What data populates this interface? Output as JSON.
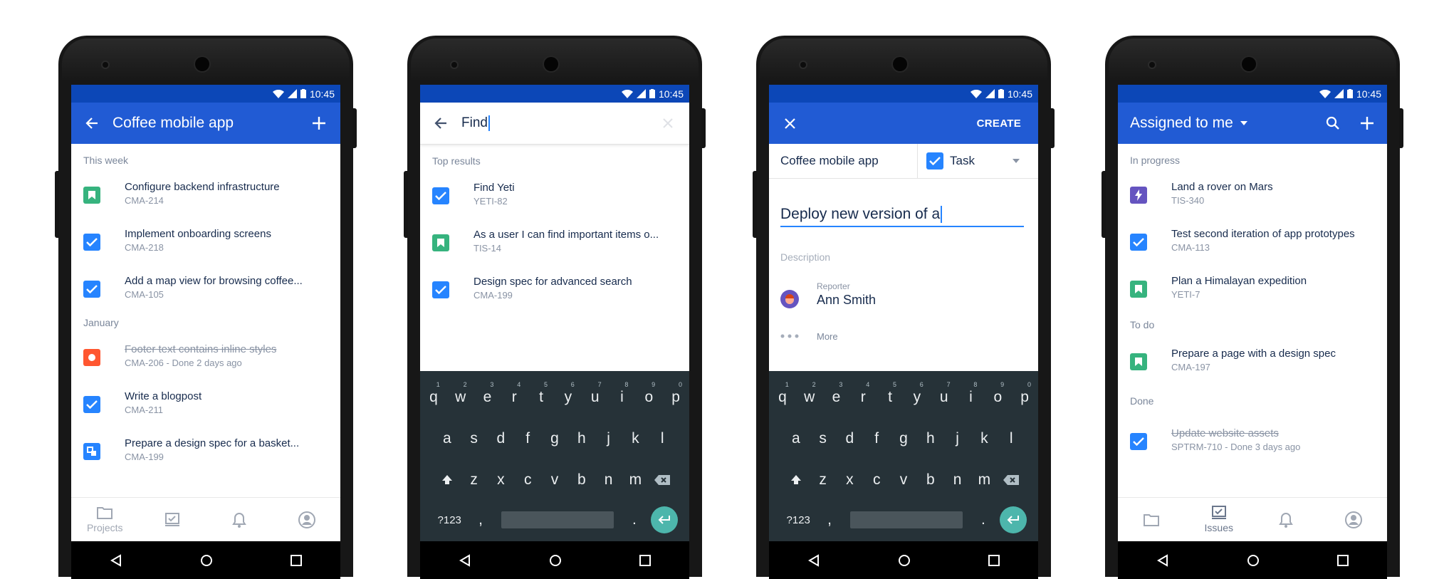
{
  "status": {
    "time": "10:45"
  },
  "screen1": {
    "title": "Coffee mobile app",
    "section_week": "This week",
    "section_january": "January",
    "items_week": [
      {
        "title": "Configure backend infrastructure",
        "meta": "CMA-214",
        "type": "story"
      },
      {
        "title": "Implement onboarding screens",
        "meta": "CMA-218",
        "type": "task"
      },
      {
        "title": "Add a map view for browsing coffee...",
        "meta": "CMA-105",
        "type": "task"
      }
    ],
    "items_january": [
      {
        "title": "Footer text contains inline styles",
        "meta": "CMA-206 - Done 2 days ago",
        "type": "bug",
        "done": true
      },
      {
        "title": "Write a blogpost",
        "meta": "CMA-211",
        "type": "task"
      },
      {
        "title": "Prepare a design spec for a basket...",
        "meta": "CMA-199",
        "type": "subtask"
      }
    ],
    "nav": {
      "projects": "Projects"
    }
  },
  "screen2": {
    "search_value": "Find",
    "section": "Top results",
    "items": [
      {
        "title": "Find Yeti",
        "meta": "YETI-82",
        "type": "task"
      },
      {
        "title": "As a user I can find important items o...",
        "meta": "TIS-14",
        "type": "story"
      },
      {
        "title": "Design spec for advanced search",
        "meta": "CMA-199",
        "type": "task"
      }
    ]
  },
  "screen3": {
    "create": "CREATE",
    "project": "Coffee mobile app",
    "issue_type": "Task",
    "summary": "Deploy new version of a",
    "description": "Description",
    "reporter_label": "Reporter",
    "reporter_name": "Ann Smith",
    "more": "More"
  },
  "screen4": {
    "title": "Assigned to me",
    "section_progress": "In progress",
    "section_todo": "To do",
    "section_done": "Done",
    "items_progress": [
      {
        "title": "Land a rover on Mars",
        "meta": "TIS-340",
        "type": "epic"
      },
      {
        "title": "Test second iteration of app prototypes",
        "meta": "CMA-113",
        "type": "task"
      },
      {
        "title": "Plan a Himalayan expedition",
        "meta": "YETI-7",
        "type": "story"
      }
    ],
    "items_todo": [
      {
        "title": "Prepare a page with a design spec",
        "meta": "CMA-197",
        "type": "story"
      }
    ],
    "items_done": [
      {
        "title": "Update website assets",
        "meta": "SPTRM-710 - Done 3 days ago",
        "type": "task",
        "done": true
      }
    ],
    "nav": {
      "issues": "Issues"
    }
  },
  "keyboard": {
    "row1": [
      "q",
      "w",
      "e",
      "r",
      "t",
      "y",
      "u",
      "i",
      "o",
      "p"
    ],
    "row1_hints": [
      "1",
      "2",
      "3",
      "4",
      "5",
      "6",
      "7",
      "8",
      "9",
      "0"
    ],
    "row2": [
      "a",
      "s",
      "d",
      "f",
      "g",
      "h",
      "j",
      "k",
      "l"
    ],
    "row3": [
      "z",
      "x",
      "c",
      "v",
      "b",
      "n",
      "m"
    ],
    "sym": "?123",
    "comma": ",",
    "period": "."
  },
  "colors": {
    "brand_blue": "#215bd4",
    "status_blue": "#0c47b7",
    "keyboard": "#263238",
    "enter": "#4db6ac"
  },
  "icons": [
    "wifi-icon",
    "signal-icon",
    "battery-icon",
    "back-arrow-icon",
    "plus-icon",
    "close-icon",
    "search-icon",
    "check-icon",
    "bookmark-icon",
    "bug-icon",
    "lightning-icon",
    "subtask-icon",
    "folder-icon",
    "dashboard-icon",
    "bell-icon",
    "avatar-icon",
    "backspace-icon",
    "shift-icon",
    "enter-icon",
    "nav-back-icon",
    "nav-home-icon",
    "nav-recents-icon"
  ]
}
